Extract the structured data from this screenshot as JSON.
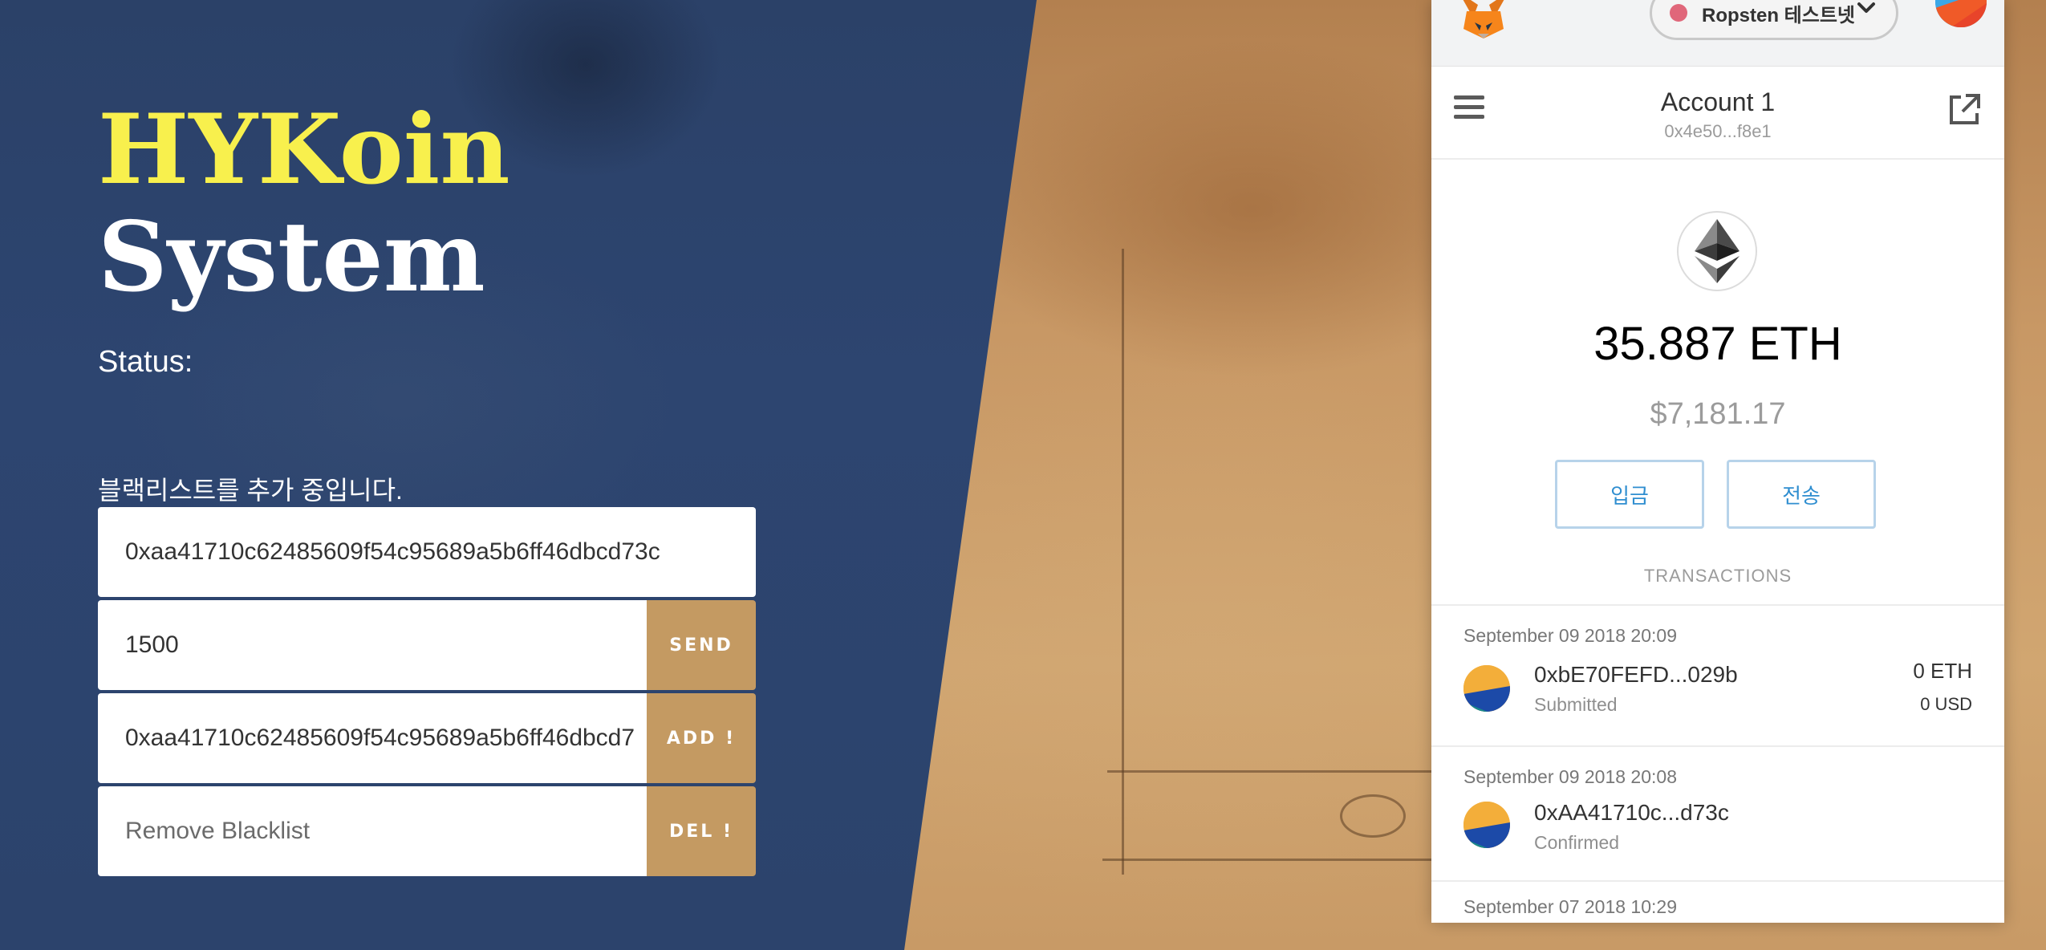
{
  "hero": {
    "title_line1": "HYKoin",
    "title_line2": "System",
    "status_label": "Status:",
    "notice": "블랙리스트를 추가 중입니다."
  },
  "form": {
    "address_value": "0xaa41710c62485609f54c95689a5b6ff46dbcd73c",
    "amount_value": "1500",
    "send_label": "SEND",
    "add_value": "0xaa41710c62485609f54c95689a5b6ff46dbcd7",
    "add_label": "ADD !",
    "remove_placeholder": "Remove Blacklist",
    "del_label": "DEL !"
  },
  "metamask": {
    "network": "Ropsten 테스트넷",
    "account_name": "Account 1",
    "account_address": "0x4e50...f8e1",
    "balance_eth": "35.887 ETH",
    "balance_usd": "$7,181.17",
    "deposit_label": "입금",
    "send_label": "전송",
    "transactions_heading": "TRANSACTIONS",
    "transactions": [
      {
        "date": "September 09 2018 20:09",
        "address": "0xbE70FEFD...029b",
        "status": "Submitted",
        "amount": "0 ETH",
        "usd": "0 USD"
      },
      {
        "date": "September 09 2018 20:08",
        "address": "0xAA41710c...d73c",
        "status": "Confirmed",
        "amount": "",
        "usd": ""
      },
      {
        "date": "September 07 2018 10:29",
        "address": "",
        "status": "",
        "amount": "",
        "usd": ""
      }
    ]
  },
  "colors": {
    "navy": "#2c436c",
    "title_yellow": "#f8f04d",
    "button_tan": "#c49a62",
    "metamask_blue": "#2f8ed0"
  },
  "icons": [
    "metamask-fox-icon",
    "chevron-down-icon",
    "menu-icon",
    "external-link-icon",
    "ethereum-icon",
    "identicon-icon"
  ]
}
